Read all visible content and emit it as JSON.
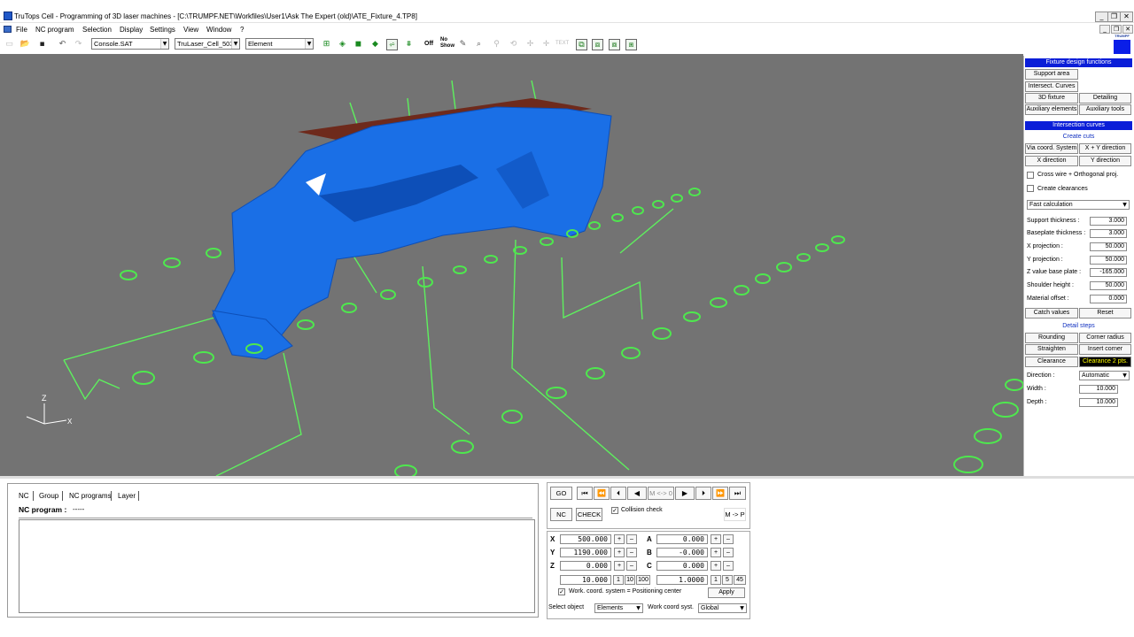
{
  "window": {
    "title": "TruTops Cell - Programming of 3D laser machines - [C:\\TRUMPF.NET\\Workfiles\\User1\\Ask The Expert (old)\\ATE_Fixture_4.TP8]",
    "minimize": "_",
    "restore": "❐",
    "close": "✕"
  },
  "menu": {
    "items": [
      "File",
      "NC program",
      "Selection",
      "Display",
      "Settings",
      "View",
      "Window",
      "?"
    ],
    "logo": "TRUMPF"
  },
  "toolbar": {
    "combo1": "Console.SAT",
    "combo2": "TruLaser_Cell_503",
    "combo3": "Element",
    "off_label": "Off",
    "no_show_label1": "No",
    "no_show_label2": "Show",
    "text_label": "TEXT"
  },
  "fixture_panel": {
    "header": "Fixture design functions",
    "buttons": [
      "Support area",
      "Intersect. Curves",
      "3D fixture",
      "Detailing",
      "Auxiliary elements",
      "Auxiliary tools"
    ],
    "intersection_header": "Intersection curves",
    "create_cuts": "Create cuts",
    "cut_buttons": [
      "Via coord. System",
      "X + Y direction",
      "X direction",
      "Y direction"
    ],
    "cross_wire_label": "Cross wire + Orthogonal proj.",
    "create_clearances_label": "Create clearances",
    "calc_mode": "Fast calculation",
    "params": [
      {
        "label": "Support thickness :",
        "value": "3.000"
      },
      {
        "label": "Baseplate thickness :",
        "value": "3.000"
      },
      {
        "label": "X projection :",
        "value": "50.000"
      },
      {
        "label": "Y projection :",
        "value": "50.000"
      },
      {
        "label": "Z value base plate :",
        "value": "-165.000"
      },
      {
        "label": "Shoulder height :",
        "value": "50.000"
      },
      {
        "label": "Material offset :",
        "value": "0.000"
      }
    ],
    "catch_values": "Catch values",
    "reset": "Reset",
    "detail_steps": "Detail steps",
    "detail_buttons": [
      "Rounding",
      "Corner radius",
      "Straighten",
      "Insert corner",
      "Clearance",
      "Clearance 2 pts."
    ],
    "direction_label": "Direction :",
    "direction_value": "Automatic",
    "width_label": "Width :",
    "width_value": "10.000",
    "depth_label": "Depth :",
    "depth_value": "10.000"
  },
  "nc_panel": {
    "tabs": [
      "NC",
      "Group",
      "NC programs",
      "Layer"
    ],
    "program_label": "NC program :",
    "program_value": "-----"
  },
  "controls": {
    "go": "GO",
    "m_label": "M <-> 0",
    "nc": "NC",
    "check": "CHECK",
    "collision_check": "Collision check",
    "m_to_p": "M -> P"
  },
  "coords": {
    "x_label": "X",
    "x_value": "500.000",
    "y_label": "Y",
    "y_value": "1190.000",
    "z_label": "Z",
    "z_value": "0.000",
    "a_label": "A",
    "a_value": "0.000",
    "b_label": "B",
    "b_value": "-0.000",
    "c_label": "C",
    "c_value": "0.000",
    "step_lin": "10.000",
    "step_ang": "1.0000",
    "plus": "+",
    "minus": "–",
    "step_lin_opts": [
      "1",
      "10",
      "100"
    ],
    "step_ang_opts": [
      "1",
      "5",
      "45"
    ],
    "work_coord_label": "Work. coord. system = Positioning center",
    "apply": "Apply",
    "select_object_label": "Select object",
    "select_object_value": "Elements",
    "work_coord_syst_label": "Work coord syst.",
    "work_coord_syst_value": "Global"
  },
  "axis_labels": {
    "z": "Z",
    "x": "X"
  },
  "colors": {
    "viewport_bg": "#737373",
    "part_blue": "#1a6fe6",
    "support_green": "#4ee84e",
    "panel_header": "#0b1ed8",
    "plate_red": "#6e2a1c"
  }
}
